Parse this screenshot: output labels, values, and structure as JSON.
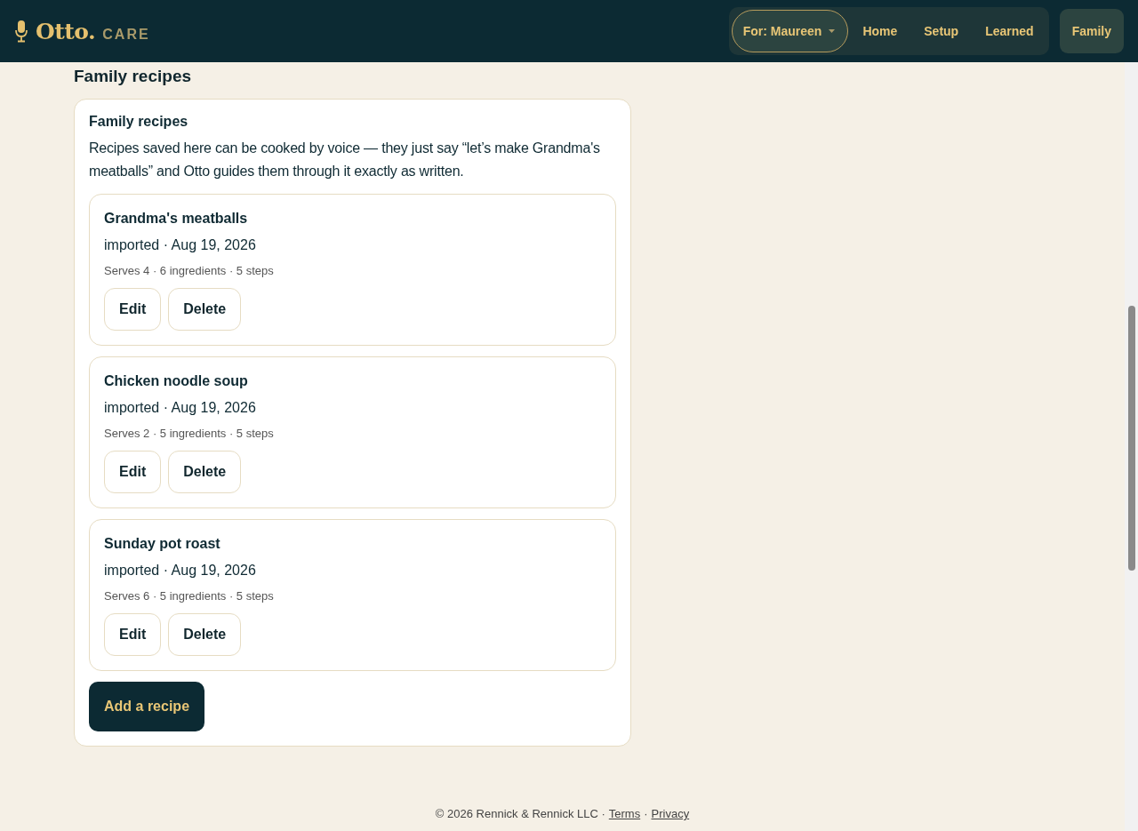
{
  "brand": {
    "name": "Otto.",
    "suffix": "CARE"
  },
  "nav": {
    "profile": "For: Maureen",
    "items": [
      {
        "label": "Home",
        "selected": false
      },
      {
        "label": "Setup",
        "selected": false
      },
      {
        "label": "Learned",
        "selected": false
      },
      {
        "label": "Family",
        "selected": true
      }
    ]
  },
  "section_title": "Family recipes",
  "card": {
    "title": "Family recipes",
    "description": "Recipes saved here can be cooked by voice — they just say “let’s make Grandma's meatballs” and Otto guides them through it exactly as written.",
    "recipes": [
      {
        "name": "Grandma's meatballs",
        "source": "imported · Aug 19, 2026",
        "details": "Serves 4 · 6 ingredients · 5 steps",
        "actions": [
          "Edit",
          "Delete"
        ]
      },
      {
        "name": "Chicken noodle soup",
        "source": "imported · Aug 19, 2026",
        "details": "Serves 2 · 5 ingredients · 5 steps",
        "actions": [
          "Edit",
          "Delete"
        ]
      },
      {
        "name": "Sunday pot roast",
        "source": "imported · Aug 19, 2026",
        "details": "Serves 6 · 5 ingredients · 5 steps",
        "actions": [
          "Edit",
          "Delete"
        ]
      }
    ],
    "add_button": "Add a recipe"
  },
  "footer": {
    "copyright": "© 2026 Rennick & Rennick LLC ·",
    "links": [
      "Terms",
      "Privacy"
    ],
    "separator": "·"
  }
}
